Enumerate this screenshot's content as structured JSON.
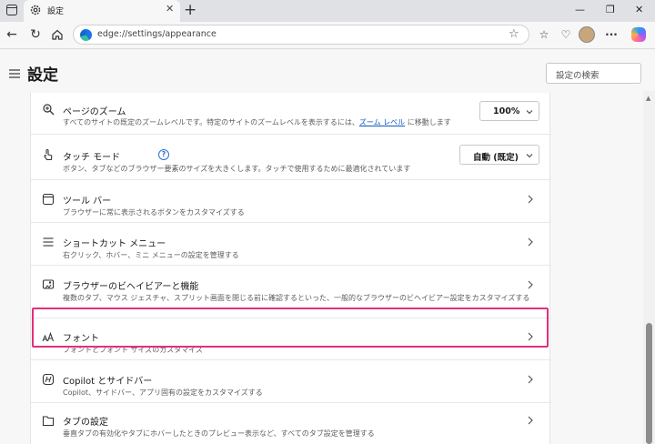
{
  "browser": {
    "tab_title": "設定",
    "new_tab": "+",
    "close_tab": "✕",
    "window_buttons": [
      "—",
      "❐",
      "✕"
    ],
    "url": "edge://settings/appearance"
  },
  "page": {
    "title": "設定",
    "search_placeholder": "設定の検索"
  },
  "settings": {
    "zoom": {
      "title": "ページのズーム",
      "desc_prefix": "すべてのサイトの既定のズームレベルです。特定のサイトのズームレベルを表示するには、",
      "desc_link": "ズーム レベル",
      "desc_suffix": " に移動します",
      "value": "100%"
    },
    "touch": {
      "title": "タッチ モード",
      "help": "?",
      "desc": "ボタン、タブなどのブラウザー要素のサイズを大きくします。タッチで使用するために最適化されています",
      "value": "自動 (既定)"
    },
    "toolbar": {
      "title": "ツール バー",
      "desc": "ブラウザーに常に表示されるボタンをカスタマイズする"
    },
    "context_menu": {
      "title": "ショートカット メニュー",
      "desc": "右クリック、ホバー、ミニ メニューの設定を管理する"
    },
    "behavior": {
      "title": "ブラウザーのビヘイビアーと機能",
      "desc": "複数のタブ、マウス ジェスチャ、スプリット画面を閉じる前に確認するといった、一般的なブラウザーのビヘイビアー設定をカスタマイズする"
    },
    "fonts": {
      "title": "フォント",
      "desc": "フォントとフォント サイズのカスタマイズ"
    },
    "copilot": {
      "title": "Copilot とサイドバー",
      "desc": "Copilot、サイドバー、アプリ固有の設定をカスタマイズする"
    },
    "tabs": {
      "title": "タブの設定",
      "desc": "垂直タブの有効化やタブにホバーしたときのプレビュー表示など、すべてのタブ設定を管理する"
    }
  },
  "colors": {
    "highlight": "#e1307c",
    "link": "#0b57c2"
  }
}
